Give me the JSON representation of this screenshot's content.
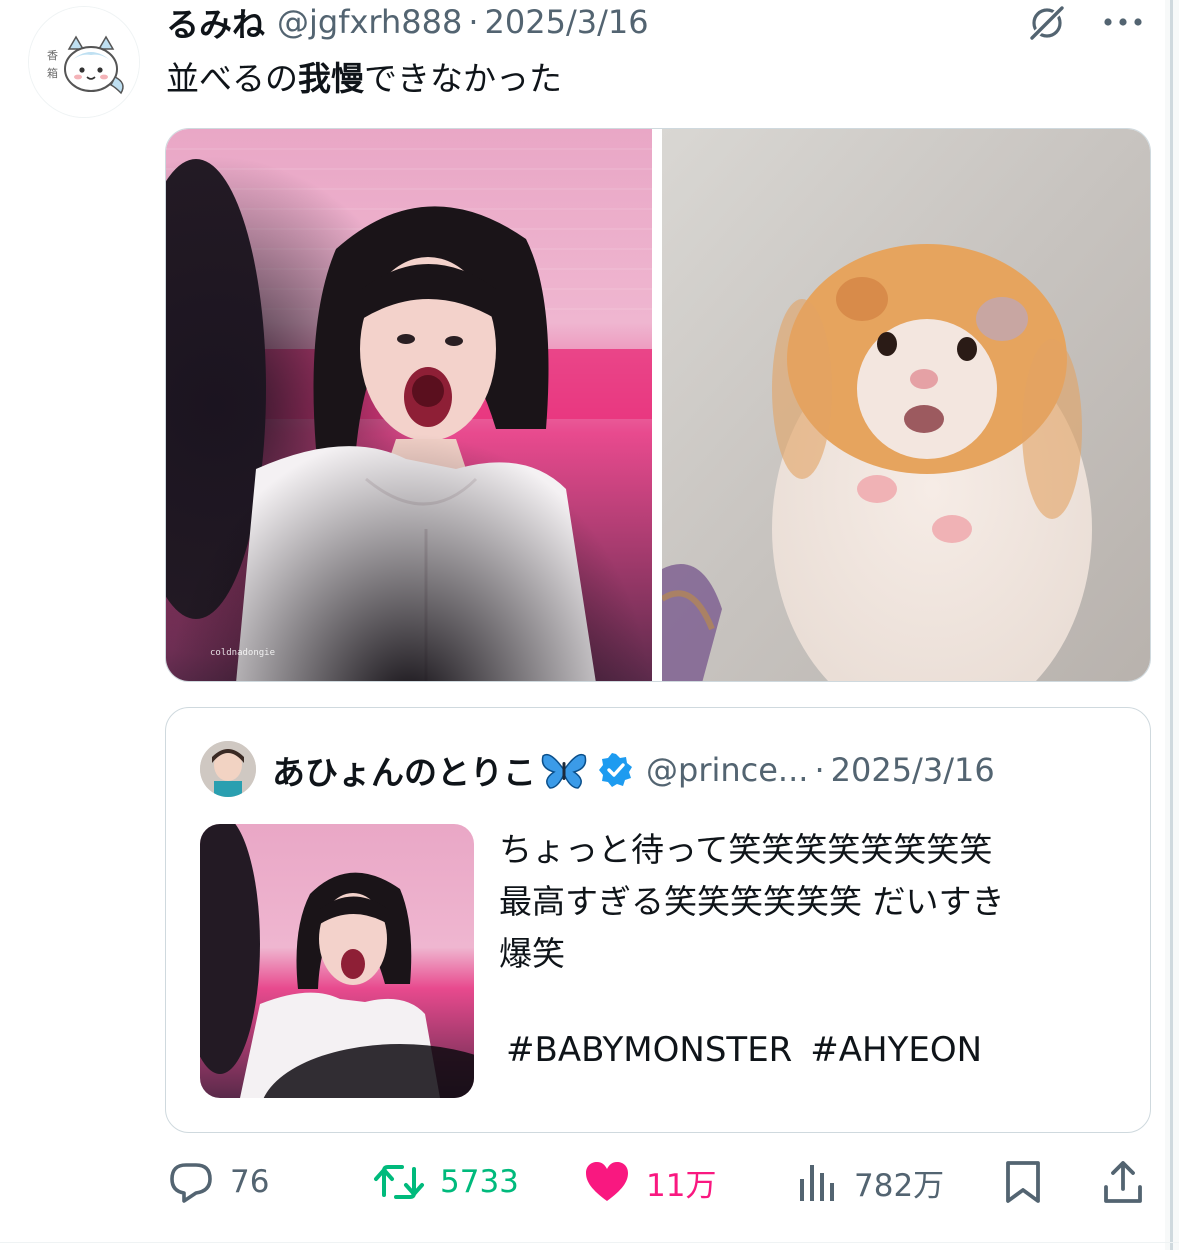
{
  "tweet": {
    "display_name": "るみね",
    "handle": "@jgfxrh888",
    "separator": "·",
    "date": "2025/3/16",
    "text_before": "並べるの",
    "text_bold": "我慢",
    "text_after": "できなかった",
    "avatar_icon": "chiikawa-hachiware-avatar",
    "watermark": "coldnadongie"
  },
  "quote": {
    "display_name": "あひょんのとりこ",
    "handle": "@prince...",
    "separator": "·",
    "date": "2025/3/16",
    "lines": [
      "ちょっと待って笑笑笑笑笑笑笑笑",
      "最高すぎる笑笑笑笑笑笑 だいすき",
      "爆笑"
    ],
    "hashtags": [
      "#BABYMONSTER",
      "#AHYEON"
    ]
  },
  "actions": {
    "replies": "76",
    "retweets": "5733",
    "likes": "11万",
    "views": "782万"
  },
  "colors": {
    "text": "#0f1419",
    "secondary": "#536471",
    "retweet_green": "#00ba7c",
    "like_pink": "#f91880",
    "verified_blue": "#1d9bf0",
    "border": "#cfd9de"
  }
}
